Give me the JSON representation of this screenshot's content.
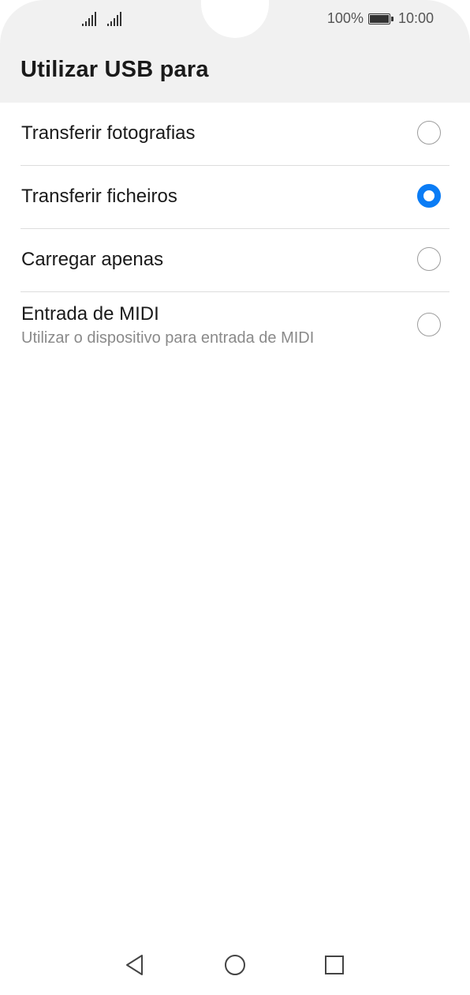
{
  "status_bar": {
    "signal_icons": [
      "signal-icon",
      "signal-icon"
    ],
    "battery_percent_text": "100%",
    "battery_icon": "battery-full-icon",
    "time": "10:00"
  },
  "header": {
    "title": "Utilizar USB para"
  },
  "options": [
    {
      "label": "Transferir fotografias",
      "sublabel": "",
      "selected": false
    },
    {
      "label": "Transferir ficheiros",
      "sublabel": "",
      "selected": true
    },
    {
      "label": "Carregar apenas",
      "sublabel": "",
      "selected": false
    },
    {
      "label": "Entrada de MIDI",
      "sublabel": "Utilizar o dispositivo para entrada de MIDI",
      "selected": false
    }
  ],
  "navigation_bar": {
    "back_icon": "back-triangle-icon",
    "home_icon": "home-circle-icon",
    "recents_icon": "recents-square-icon"
  },
  "colors": {
    "accent": "#0a7cf5",
    "header_background": "#f1f1f1",
    "divider": "#dddddd"
  }
}
